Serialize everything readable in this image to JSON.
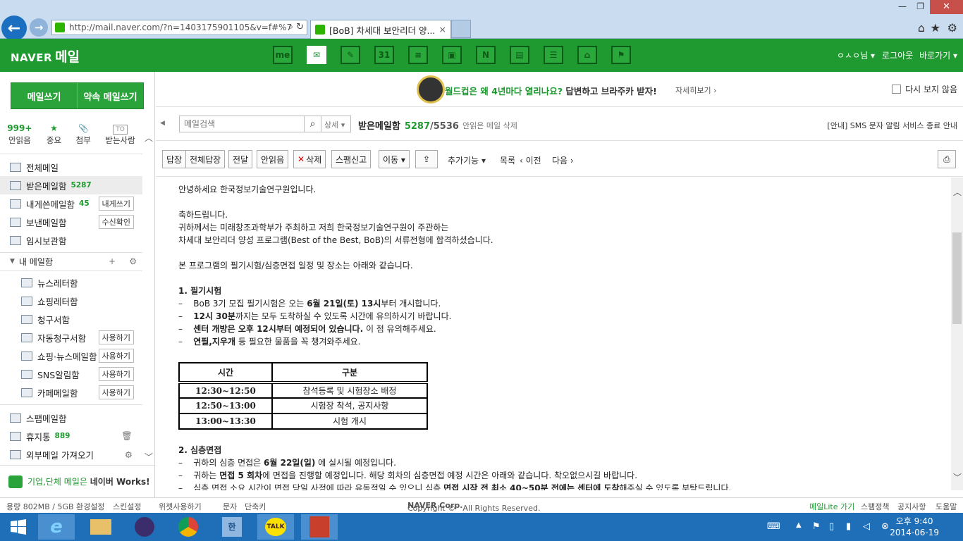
{
  "browser": {
    "url": "http://mail.naver.com/?n=1403175901105&v=f#%7",
    "tab_title": "[BoB] 차세대 보안리더 양...",
    "tab_close": "×"
  },
  "gnb": {
    "logo_brand": "NAVER",
    "logo_text": "메일",
    "user": "ㅇㅅㅇ님",
    "logout": "로그아웃",
    "shortcut": "바로가기",
    "services": [
      "me",
      "mail",
      "memo",
      "31",
      "list",
      "profile",
      "N",
      "cafe",
      "blog",
      "stock",
      "run"
    ]
  },
  "sidebar": {
    "write": "메일쓰기",
    "promise_write": "약속 메일쓰기",
    "quick": [
      {
        "num": "999+",
        "label": "안읽음"
      },
      {
        "num": "★",
        "label": "중요"
      },
      {
        "num": "📎",
        "label": "첨부"
      },
      {
        "num": "TO",
        "label": "받는사람"
      }
    ],
    "boxes": [
      {
        "label": "전체메일",
        "count": "",
        "btn": ""
      },
      {
        "label": "받은메일함",
        "count": "5287",
        "btn": ""
      },
      {
        "label": "내게쓴메일함",
        "count": "45",
        "btn": "내게쓰기"
      },
      {
        "label": "보낸메일함",
        "count": "",
        "btn": "수신확인"
      },
      {
        "label": "임시보관함",
        "count": "",
        "btn": ""
      }
    ],
    "my_box_header": "내 메일함",
    "my_boxes": [
      {
        "label": "뉴스레터함",
        "btn": ""
      },
      {
        "label": "쇼핑레터함",
        "btn": ""
      },
      {
        "label": "청구서함",
        "btn": ""
      },
      {
        "label": "자동청구서함",
        "btn": "사용하기"
      },
      {
        "label": "쇼핑·뉴스메일함",
        "btn": "사용하기"
      },
      {
        "label": "SNS알림함",
        "btn": "사용하기"
      },
      {
        "label": "카페메일함",
        "btn": "사용하기"
      }
    ],
    "bottom_boxes": [
      {
        "label": "스팸메일함",
        "count": ""
      },
      {
        "label": "휴지통",
        "count": "889"
      },
      {
        "label": "외부메일 가져오기",
        "count": ""
      }
    ],
    "works_text": "기업,단체 메일은",
    "works_brand": "네이버 Works!"
  },
  "banner": {
    "text1": "월드컵은 왜 4년마다 열리나요?",
    "text2": "답변하고 브라주카 받자!",
    "more": "자세히보기 ›",
    "no_show": "다시 보지 않음"
  },
  "search": {
    "placeholder": "메일검색",
    "detail": "상세 ▾",
    "box_title": "받은메일함",
    "unread": "5287",
    "total": "/5536",
    "unread_delete": "안읽은 메일 삭제",
    "notice": "[안내] SMS 문자 알림 서비스 종료 안내"
  },
  "toolbar": {
    "reply": "답장",
    "reply_all": "전체답장",
    "forward": "전달",
    "unread": "안읽음",
    "delete": "삭제",
    "spam": "스팸신고",
    "move": "이동 ▾",
    "more": "추가기능 ▾",
    "list": "목록",
    "prev": "‹ 이전",
    "next": "다음 ›"
  },
  "mail": {
    "greeting": "안녕하세요 한국정보기술연구원입니다.",
    "congrats": "축하드립니다.",
    "line1": "귀하께서는 미래창조과학부가 주최하고 저희 한국정보기술연구원이 주관하는",
    "line2": "차세대 보안리더 양성 프로그램(Best of the Best, BoB)의 서류전형에 합격하셨습니다.",
    "line3": "본 프로그램의 필기시험/심층면접 일정 및 장소는 아래와 같습니다.",
    "sec1": "1.   필기시험",
    "s1b1a": "BoB 3기 모집 필기시험은 오는 ",
    "s1b1b": "6월 21일(토) 13시",
    "s1b1c": "부터 개시합니다.",
    "s1b2a": "12시 30분",
    "s1b2b": "까지는 모두 도착하실 수 있도록 시간에 유의하시기 바랍니다.",
    "s1b3a": "센터 개방은 오후 12시부터 예정되어 있습니다.",
    "s1b3b": " 이 점 유의해주세요.",
    "s1b4a": "연필,지우개",
    "s1b4b": " 등 필요한 물품을 꼭 챙겨와주세요.",
    "table_head": [
      "시간",
      "구분"
    ],
    "table_rows": [
      [
        "12:30~12:50",
        "참석등록 및 시험장소 배정"
      ],
      [
        "12:50~13:00",
        "시험장 착석, 공지사항"
      ],
      [
        "13:00~13:30",
        "시험 개시"
      ]
    ],
    "sec2": "2.   심층면접",
    "s2b1a": "귀하의 심층 면접은 ",
    "s2b1b": "6월 22일(일)",
    "s2b1c": " 에 실시될 예정입니다.",
    "s2b2a": "귀하는 ",
    "s2b2b": "면접 5 회차",
    "s2b2c": "에 면접을 진행할 예정입니다. 해당 회차의 심층면접 예정 시간은 아래와 같습니다. 착오없으시길 바랍니다.",
    "s2b3a": "심층 면접 소요 시간이 면접 당일 사정에 따라 유동적일 수 있으니 심층 ",
    "s2b3b": "면접 시작 전 최소 40~50분 전에는 센터에 도착",
    "s2b3c": "해주실 수 있도록 부탁드립니다."
  },
  "footer": {
    "usage": "용량 802MB / 5GB",
    "env": "환경설정",
    "skin": "스킨설정",
    "widget": "위젯사용하기",
    "sms": "문자",
    "shortcut": "단축키",
    "copyright": "Copyright ©",
    "corp": "NAVER Corp.",
    "rights": "All Rights Reserved.",
    "lite": "메일Lite 가기",
    "spam_policy": "스팸정책",
    "notice": "공지사항",
    "help": "도움말"
  },
  "taskbar": {
    "time": "오후 9:40",
    "date": "2014-06-19",
    "apps": [
      "ie",
      "explorer",
      "eclipse",
      "chrome",
      "hangul",
      "kakaotalk",
      "acrobat"
    ]
  },
  "colors": {
    "naver_green": "#1f9a30",
    "taskbar": "#1f6fb8"
  }
}
